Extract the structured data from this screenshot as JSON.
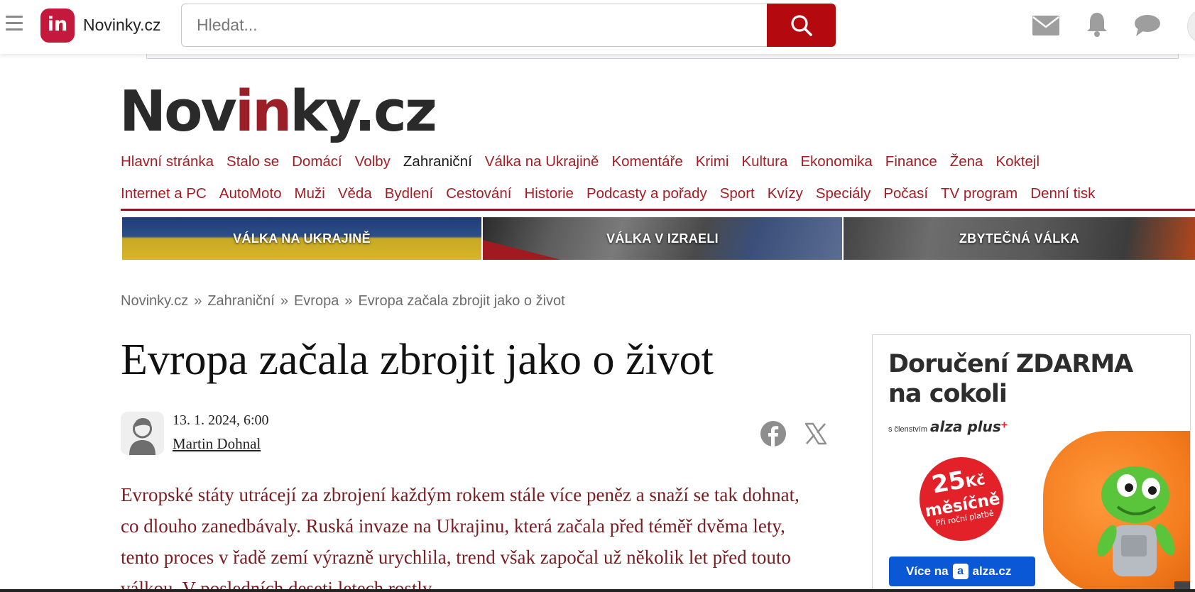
{
  "topbar": {
    "app_logo": "in",
    "app_name": "Novinky.cz",
    "search_placeholder": "Hledat..."
  },
  "masthead": {
    "part1": "Nov",
    "part2": "in",
    "part3": "ky.cz"
  },
  "nav": {
    "row1": [
      "Hlavní stránka",
      "Stalo se",
      "Domácí",
      "Volby",
      "Zahraniční",
      "Válka na Ukrajině",
      "Komentáře",
      "Krimi",
      "Kultura",
      "Ekonomika",
      "Finance",
      "Žena",
      "Koktejl"
    ],
    "row2": [
      "Internet a PC",
      "AutoMoto",
      "Muži",
      "Věda",
      "Bydlení",
      "Cestování",
      "Historie",
      "Podcasty a pořady",
      "Sport",
      "Kvízy",
      "Speciály",
      "Počasí",
      "TV program",
      "Denní tisk"
    ],
    "active": "Zahraniční"
  },
  "banners": [
    "VÁLKA NA UKRAJINĚ",
    "VÁLKA V IZRAELI",
    "ZBYTEČNÁ VÁLKA"
  ],
  "breadcrumb": [
    "Novinky.cz",
    "Zahraniční",
    "Evropa",
    "Evropa začala zbrojit jako o život"
  ],
  "breadcrumb_separator": "»",
  "article": {
    "title": "Evropa začala zbrojit jako o život",
    "date": "13. 1. 2024, 6:00",
    "author": "Martin Dohnal",
    "perex": "Evropské státy utrácejí za zbrojení každým rokem stále více peněz a snaží se tak dohnat, co dlouho zanedbávaly. Ruská invaze na Ukrajinu, která začala před téměř dvěma lety, tento proces v řadě zemí výrazně urychlila, trend však započal už několik let před touto válkou. V posledních deseti letech rostly"
  },
  "ad": {
    "title_line1": "Doručení ZDARMA",
    "title_line2": "na cokoli",
    "sub_prefix": "s členstvím",
    "sub_brand": "alza plus",
    "sub_plus": "+",
    "badge_price": "25",
    "badge_currency": "Kč",
    "badge_period": "měsíčně",
    "badge_note": "Při roční platbě",
    "cta_label": "Více na",
    "cta_brand": "alza.cz"
  },
  "colors": {
    "brand_red": "#a51d24",
    "search_button": "#b3090f",
    "logo_bg": "#c4183c",
    "perex": "#7b1c22",
    "ad_cta": "#0a58d6"
  },
  "icons": {
    "menu": "hamburger-icon",
    "search": "search-icon",
    "mail": "mail-icon",
    "notifications": "bell-icon",
    "chat": "chat-icon",
    "facebook": "facebook-icon",
    "x": "x-icon",
    "author": "user-icon"
  }
}
